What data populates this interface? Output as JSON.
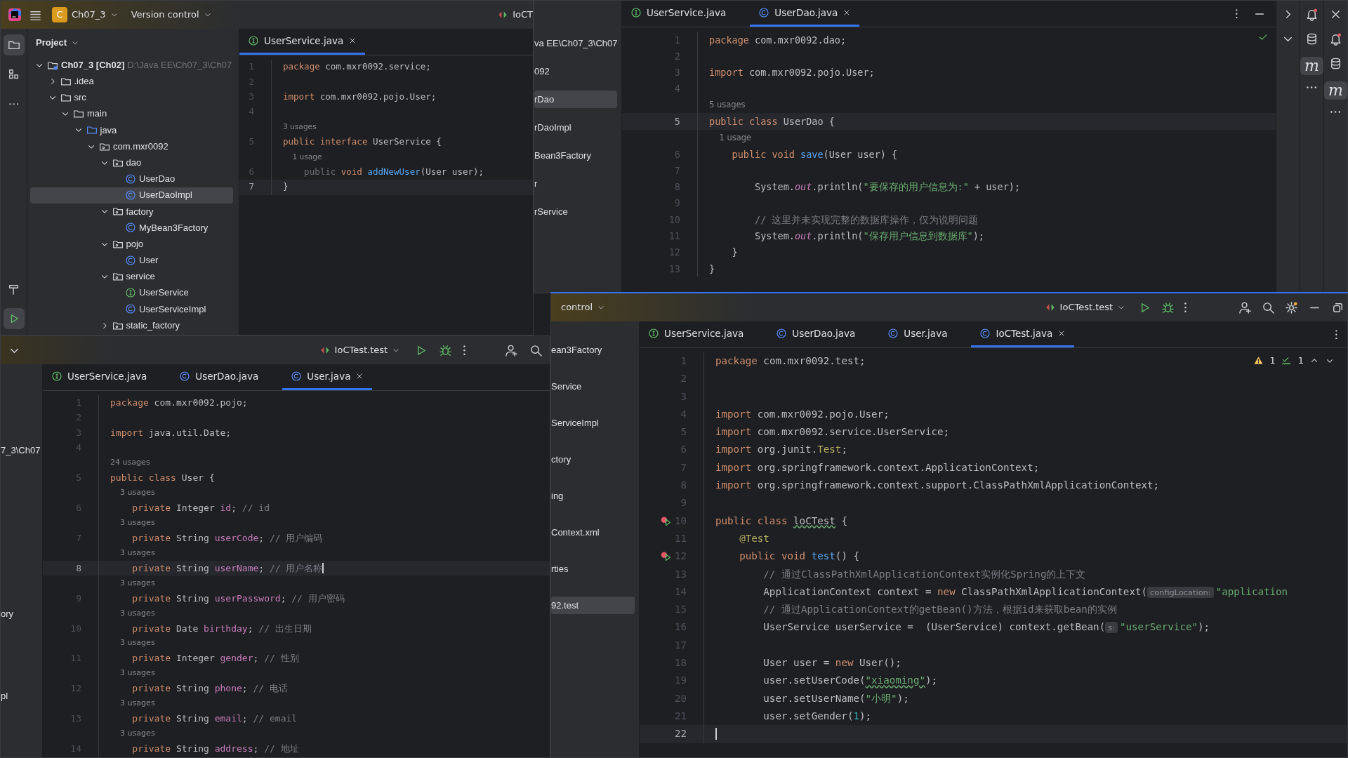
{
  "windows": [
    {
      "header": [
        {
          "kind": "project",
          "badge": "C",
          "label": "Ch07_3"
        },
        {
          "kind": "dropdown",
          "label": "Version control"
        },
        {
          "kind": "runconfig",
          "label": "IoCT",
          "caret": false
        }
      ],
      "tool_strip": [
        {
          "selected": true
        },
        {
          "selected": false
        },
        {
          "selected": false
        },
        {
          "selected": false
        },
        {
          "selected": true
        }
      ],
      "panel": {
        "title": "Project",
        "tree": [
          {
            "label": "Ch07_3 [Ch02]",
            "path": "D:\\Java EE\\Ch07_3\\Ch07",
            "kind": "module",
            "expanded": true,
            "selected": false,
            "children": [
              {
                "label": ".idea",
                "kind": "folder",
                "expanded": false,
                "selected": false
              },
              {
                "label": "src",
                "kind": "folder",
                "expanded": true,
                "selected": false,
                "children": [
                  {
                    "label": "main",
                    "kind": "folder",
                    "expanded": true,
                    "selected": false,
                    "children": [
                      {
                        "label": "java",
                        "kind": "source",
                        "expanded": true,
                        "selected": false,
                        "children": [
                          {
                            "label": "com.mxr0092",
                            "kind": "package",
                            "expanded": true,
                            "selected": false,
                            "children": [
                              {
                                "label": "dao",
                                "kind": "package",
                                "expanded": true,
                                "selected": false,
                                "children": [
                                  {
                                    "label": "UserDao",
                                    "kind": "class",
                                    "selected": false
                                  },
                                  {
                                    "label": "UserDaoImpl",
                                    "kind": "class",
                                    "selected": true
                                  }
                                ]
                              },
                              {
                                "label": "factory",
                                "kind": "package",
                                "expanded": true,
                                "selected": false,
                                "children": [
                                  {
                                    "label": "MyBean3Factory",
                                    "kind": "class",
                                    "selected": false
                                  }
                                ]
                              },
                              {
                                "label": "pojo",
                                "kind": "package",
                                "expanded": true,
                                "selected": false,
                                "children": [
                                  {
                                    "label": "User",
                                    "kind": "class",
                                    "selected": false
                                  }
                                ]
                              },
                              {
                                "label": "service",
                                "kind": "package",
                                "expanded": true,
                                "selected": false,
                                "children": [
                                  {
                                    "label": "UserService",
                                    "kind": "interface",
                                    "selected": false
                                  },
                                  {
                                    "label": "UserServiceImpl",
                                    "kind": "class",
                                    "selected": false
                                  }
                                ]
                              },
                              {
                                "label": "static_factory",
                                "kind": "package",
                                "expanded": false,
                                "selected": false
                              }
                            ]
                          }
                        ]
                      }
                    ]
                  }
                ]
              }
            ]
          }
        ]
      },
      "tabs": [
        {
          "label": "UserService.java",
          "kind": "interface",
          "selected": true
        }
      ],
      "editor": {
        "caret": false,
        "lines": [
          {
            "kind": "code",
            "number": "1",
            "current": false,
            "segments": [
              {
                "kind": "kw",
                "text": "package"
              },
              {
                "kind": "t",
                "text": " com.mxr0092.service;"
              }
            ]
          },
          {
            "kind": "code",
            "number": "2",
            "current": false
          },
          {
            "kind": "code",
            "number": "3",
            "current": false,
            "segments": [
              {
                "kind": "kw",
                "text": "import"
              },
              {
                "kind": "t",
                "text": " com.mxr0092.pojo.User;"
              }
            ]
          },
          {
            "kind": "code",
            "number": "4",
            "current": false
          },
          {
            "kind": "usage",
            "text": "3 usages"
          },
          {
            "kind": "code",
            "number": "5",
            "current": false,
            "segments": [
              {
                "kind": "kw",
                "text": "public interface"
              },
              {
                "kind": "t",
                "text": " UserService {"
              }
            ]
          },
          {
            "kind": "usage",
            "text": "    1 usage"
          },
          {
            "kind": "code",
            "number": "6",
            "current": false,
            "segments": [
              {
                "kind": "dim",
                "text": "    public"
              },
              {
                "kind": "kw",
                "text": " void"
              },
              {
                "kind": "fn",
                "text": " addNewUser"
              },
              {
                "kind": "t",
                "text": "(User user);"
              }
            ]
          },
          {
            "kind": "code",
            "number": "7",
            "current": true,
            "segments": [
              {
                "kind": "t",
                "text": "}"
              }
            ]
          }
        ]
      }
    },
    {
      "panel": {
        "fragments": [
          {
            "text": "va EE\\Ch07_3\\Ch07",
            "selected": false
          },
          {
            "text": "092",
            "selected": false
          },
          {
            "text": "rDao",
            "selected": true
          },
          {
            "text": "rDaoImpl",
            "selected": false
          },
          {
            "text": "Bean3Factory",
            "selected": false
          },
          {
            "text": "r",
            "selected": false
          },
          {
            "text": "rService",
            "selected": false
          }
        ]
      },
      "tabs": [
        {
          "label": "UserService.java",
          "kind": "interface",
          "selected": false
        },
        {
          "label": "UserDao.java",
          "kind": "class",
          "selected": true
        }
      ],
      "tool_labels": [
        "m",
        "m"
      ],
      "editor": {
        "caret": false,
        "checks_passed": true,
        "lines": [
          {
            "kind": "code",
            "number": "1",
            "current": false,
            "segments": [
              {
                "kind": "kw",
                "text": "package"
              },
              {
                "kind": "t",
                "text": " com.mxr0092.dao;"
              }
            ]
          },
          {
            "kind": "code",
            "number": "2",
            "current": false
          },
          {
            "kind": "code",
            "number": "3",
            "current": false,
            "segments": [
              {
                "kind": "kw",
                "text": "import"
              },
              {
                "kind": "t",
                "text": " com.mxr0092.pojo.User;"
              }
            ]
          },
          {
            "kind": "code",
            "number": "4",
            "current": false
          },
          {
            "kind": "usage",
            "text": "5 usages"
          },
          {
            "kind": "code",
            "number": "5",
            "current": true,
            "segments": [
              {
                "kind": "kw",
                "text": "public class"
              },
              {
                "kind": "t",
                "text": " UserDao {"
              }
            ]
          },
          {
            "kind": "usage",
            "text": "    1 usage"
          },
          {
            "kind": "code",
            "number": "6",
            "current": false,
            "segments": [
              {
                "kind": "kw",
                "text": "    public void"
              },
              {
                "kind": "fn",
                "text": " save"
              },
              {
                "kind": "t",
                "text": "(User user) {"
              }
            ]
          },
          {
            "kind": "code",
            "number": "7",
            "current": false
          },
          {
            "kind": "code",
            "number": "8",
            "current": false,
            "segments": [
              {
                "kind": "t",
                "text": "        System."
              },
              {
                "kind": "static",
                "text": "out"
              },
              {
                "kind": "t",
                "text": ".println("
              },
              {
                "kind": "str",
                "text": "\"要保存的用户信息为:\""
              },
              {
                "kind": "t",
                "text": " + user);"
              }
            ]
          },
          {
            "kind": "code",
            "number": "9",
            "current": false
          },
          {
            "kind": "code",
            "number": "10",
            "current": false,
            "segments": [
              {
                "kind": "cmt",
                "text": "        // 这里并未实现完整的数据库操作，仅为说明问题"
              }
            ]
          },
          {
            "kind": "code",
            "number": "11",
            "current": false,
            "segments": [
              {
                "kind": "t",
                "text": "        System."
              },
              {
                "kind": "static",
                "text": "out"
              },
              {
                "kind": "t",
                "text": ".println("
              },
              {
                "kind": "str",
                "text": "\"保存用户信息到数据库\""
              },
              {
                "kind": "t",
                "text": ");"
              }
            ]
          },
          {
            "kind": "code",
            "number": "12",
            "current": false,
            "segments": [
              {
                "kind": "t",
                "text": "    }"
              }
            ]
          },
          {
            "kind": "code",
            "number": "13",
            "current": false,
            "segments": [
              {
                "kind": "t",
                "text": "}"
              }
            ]
          }
        ]
      }
    },
    {
      "header": [
        {
          "kind": "runconfig",
          "label": "IoCTest.test",
          "caret": true
        }
      ],
      "panel": {
        "fragments": [
          {
            "text": "7_3\\Ch07",
            "selected": false
          },
          {
            "text": "ory",
            "selected": false
          },
          {
            "text": "pl",
            "selected": false
          }
        ]
      },
      "tabs": [
        {
          "label": "UserService.java",
          "kind": "interface",
          "selected": false
        },
        {
          "label": "UserDao.java",
          "kind": "class",
          "selected": false
        },
        {
          "label": "User.java",
          "kind": "class",
          "selected": true
        }
      ],
      "editor": {
        "caret": true,
        "lines": [
          {
            "kind": "code",
            "number": "1",
            "current": false,
            "segments": [
              {
                "kind": "kw",
                "text": "package"
              },
              {
                "kind": "t",
                "text": " com.mxr0092.pojo;"
              }
            ]
          },
          {
            "kind": "code",
            "number": "2",
            "current": false
          },
          {
            "kind": "code",
            "number": "3",
            "current": false,
            "segments": [
              {
                "kind": "kw",
                "text": "import"
              },
              {
                "kind": "t",
                "text": " java.util.Date;"
              }
            ]
          },
          {
            "kind": "code",
            "number": "4",
            "current": false
          },
          {
            "kind": "usage",
            "text": "24 usages"
          },
          {
            "kind": "code",
            "number": "5",
            "current": false,
            "segments": [
              {
                "kind": "kw",
                "text": "public class"
              },
              {
                "kind": "t",
                "text": " User {"
              }
            ]
          },
          {
            "kind": "usage",
            "text": "    3 usages"
          },
          {
            "kind": "code",
            "number": "6",
            "current": false,
            "segments": [
              {
                "kind": "kw",
                "text": "    private"
              },
              {
                "kind": "t",
                "text": " Integer "
              },
              {
                "kind": "fld",
                "text": "id"
              },
              {
                "kind": "t",
                "text": "; "
              },
              {
                "kind": "cmt",
                "text": "// id"
              }
            ]
          },
          {
            "kind": "usage",
            "text": "    3 usages"
          },
          {
            "kind": "code",
            "number": "7",
            "current": false,
            "segments": [
              {
                "kind": "kw",
                "text": "    private"
              },
              {
                "kind": "t",
                "text": " String "
              },
              {
                "kind": "fld",
                "text": "userCode"
              },
              {
                "kind": "t",
                "text": "; "
              },
              {
                "kind": "cmt",
                "text": "// 用户编码"
              }
            ]
          },
          {
            "kind": "usage",
            "text": "    3 usages"
          },
          {
            "kind": "code",
            "number": "8",
            "current": true,
            "segments": [
              {
                "kind": "kw",
                "text": "    private"
              },
              {
                "kind": "t",
                "text": " String "
              },
              {
                "kind": "fld",
                "text": "userName"
              },
              {
                "kind": "t",
                "text": "; "
              },
              {
                "kind": "cmt",
                "text": "// 用户名称"
              }
            ]
          },
          {
            "kind": "usage",
            "text": "    3 usages"
          },
          {
            "kind": "code",
            "number": "9",
            "current": false,
            "segments": [
              {
                "kind": "kw",
                "text": "    private"
              },
              {
                "kind": "t",
                "text": " String "
              },
              {
                "kind": "fld",
                "text": "userPassword"
              },
              {
                "kind": "t",
                "text": "; "
              },
              {
                "kind": "cmt",
                "text": "// 用户密码"
              }
            ]
          },
          {
            "kind": "usage",
            "text": "    3 usages"
          },
          {
            "kind": "code",
            "number": "10",
            "current": false,
            "segments": [
              {
                "kind": "kw",
                "text": "    private"
              },
              {
                "kind": "t",
                "text": " Date "
              },
              {
                "kind": "fld",
                "text": "birthday"
              },
              {
                "kind": "t",
                "text": "; "
              },
              {
                "kind": "cmt",
                "text": "// 出生日期"
              }
            ]
          },
          {
            "kind": "usage",
            "text": "    3 usages"
          },
          {
            "kind": "code",
            "number": "11",
            "current": false,
            "segments": [
              {
                "kind": "kw",
                "text": "    private"
              },
              {
                "kind": "t",
                "text": " Integer "
              },
              {
                "kind": "fld",
                "text": "gender"
              },
              {
                "kind": "t",
                "text": "; "
              },
              {
                "kind": "cmt",
                "text": "// 性别"
              }
            ]
          },
          {
            "kind": "usage",
            "text": "    3 usages"
          },
          {
            "kind": "code",
            "number": "12",
            "current": false,
            "segments": [
              {
                "kind": "kw",
                "text": "    private"
              },
              {
                "kind": "t",
                "text": " String "
              },
              {
                "kind": "fld",
                "text": "phone"
              },
              {
                "kind": "t",
                "text": "; "
              },
              {
                "kind": "cmt",
                "text": "// 电话"
              }
            ]
          },
          {
            "kind": "usage",
            "text": "    3 usages"
          },
          {
            "kind": "code",
            "number": "13",
            "current": false,
            "segments": [
              {
                "kind": "kw",
                "text": "    private"
              },
              {
                "kind": "t",
                "text": " String "
              },
              {
                "kind": "fld",
                "text": "email"
              },
              {
                "kind": "t",
                "text": "; "
              },
              {
                "kind": "cmt",
                "text": "// email"
              }
            ]
          },
          {
            "kind": "usage",
            "text": "    3 usages"
          },
          {
            "kind": "code",
            "number": "14",
            "current": false,
            "segments": [
              {
                "kind": "kw",
                "text": "    private"
              },
              {
                "kind": "t",
                "text": " String "
              },
              {
                "kind": "fld",
                "text": "address"
              },
              {
                "kind": "t",
                "text": "; "
              },
              {
                "kind": "cmt",
                "text": "// 地址"
              }
            ]
          }
        ]
      }
    },
    {
      "header": [
        {
          "kind": "dropdown",
          "label": "control"
        },
        {
          "kind": "runconfig",
          "label": "IoCTest.test",
          "caret": true
        }
      ],
      "panel": {
        "fragments": [
          {
            "text": "ean3Factory",
            "selected": false
          },
          {
            "text": "Service",
            "selected": false
          },
          {
            "text": "ServiceImpl",
            "selected": false
          },
          {
            "text": "ctory",
            "selected": false
          },
          {
            "text": "ing",
            "selected": false
          },
          {
            "text": "Context.xml",
            "selected": false
          },
          {
            "text": "rties",
            "selected": false
          },
          {
            "text": "92.test",
            "selected": true
          }
        ]
      },
      "tabs": [
        {
          "label": "UserService.java",
          "kind": "interface",
          "selected": false
        },
        {
          "label": "UserDao.java",
          "kind": "class",
          "selected": false
        },
        {
          "label": "User.java",
          "kind": "class",
          "selected": false
        },
        {
          "label": "IoCTest.java",
          "kind": "class",
          "selected": true
        }
      ],
      "editor": {
        "caret": true,
        "inspection": {
          "warnings": "1",
          "typos": "1"
        },
        "lines": [
          {
            "kind": "code",
            "number": "1",
            "current": false,
            "run_marker": false,
            "segments": [
              {
                "kind": "kw",
                "text": "package"
              },
              {
                "kind": "t",
                "text": " com.mxr0092.test;"
              }
            ]
          },
          {
            "kind": "code",
            "number": "2",
            "current": false,
            "run_marker": false
          },
          {
            "kind": "code",
            "number": "3",
            "current": false,
            "run_marker": false
          },
          {
            "kind": "code",
            "number": "4",
            "current": false,
            "run_marker": false,
            "segments": [
              {
                "kind": "kw",
                "text": "import"
              },
              {
                "kind": "t",
                "text": " com.mxr0092.pojo.User;"
              }
            ]
          },
          {
            "kind": "code",
            "number": "5",
            "current": false,
            "run_marker": false,
            "segments": [
              {
                "kind": "kw",
                "text": "import"
              },
              {
                "kind": "t",
                "text": " com.mxr0092.service.UserService;"
              }
            ]
          },
          {
            "kind": "code",
            "number": "6",
            "current": false,
            "run_marker": false,
            "segments": [
              {
                "kind": "kw",
                "text": "import"
              },
              {
                "kind": "t",
                "text": " org.junit."
              },
              {
                "kind": "ann",
                "text": "Test"
              },
              {
                "kind": "t",
                "text": ";"
              }
            ]
          },
          {
            "kind": "code",
            "number": "7",
            "current": false,
            "run_marker": false,
            "segments": [
              {
                "kind": "kw",
                "text": "import"
              },
              {
                "kind": "t",
                "text": " org.springframework.context.ApplicationContext;"
              }
            ]
          },
          {
            "kind": "code",
            "number": "8",
            "current": false,
            "run_marker": false,
            "segments": [
              {
                "kind": "kw",
                "text": "import"
              },
              {
                "kind": "t",
                "text": " org.springframework.context.support.ClassPathXmlApplicationContext;"
              }
            ]
          },
          {
            "kind": "code",
            "number": "9",
            "current": false,
            "run_marker": false
          },
          {
            "kind": "code",
            "number": "10",
            "current": false,
            "run_marker": true,
            "segments": [
              {
                "kind": "kw",
                "text": "public class "
              },
              {
                "kind": "typo",
                "text": "loCTest"
              },
              {
                "kind": "t",
                "text": " {"
              }
            ]
          },
          {
            "kind": "code",
            "number": "11",
            "current": false,
            "run_marker": false,
            "segments": [
              {
                "kind": "ann",
                "text": "    @Test"
              }
            ]
          },
          {
            "kind": "code",
            "number": "12",
            "current": false,
            "run_marker": true,
            "segments": [
              {
                "kind": "kw",
                "text": "    public void"
              },
              {
                "kind": "fn",
                "text": " test"
              },
              {
                "kind": "t",
                "text": "() {"
              }
            ]
          },
          {
            "kind": "code",
            "number": "13",
            "current": false,
            "run_marker": false,
            "segments": [
              {
                "kind": "cmt",
                "text": "        // 通过ClassPathXmlApplicationContext实例化Spring的上下文"
              }
            ]
          },
          {
            "kind": "code",
            "number": "14",
            "current": false,
            "run_marker": false,
            "segments": [
              {
                "kind": "t",
                "text": "        ApplicationContext context = "
              },
              {
                "kind": "kw",
                "text": "new"
              },
              {
                "kind": "t",
                "text": " ClassPathXmlApplicationContext("
              },
              {
                "kind": "hint",
                "text": "configLocation:"
              },
              {
                "kind": "str",
                "text": "\"application"
              }
            ]
          },
          {
            "kind": "code",
            "number": "15",
            "current": false,
            "run_marker": false,
            "segments": [
              {
                "kind": "cmt",
                "text": "        // 通过ApplicationContext的getBean()方法，根据id来获取bean的实例"
              }
            ]
          },
          {
            "kind": "code",
            "number": "16",
            "current": false,
            "run_marker": false,
            "segments": [
              {
                "kind": "t",
                "text": "        UserService userService =  (UserService) context.getBean("
              },
              {
                "kind": "hint",
                "text": "s:"
              },
              {
                "kind": "str",
                "text": "\"userService\""
              },
              {
                "kind": "t",
                "text": ");"
              }
            ]
          },
          {
            "kind": "code",
            "number": "17",
            "current": false,
            "run_marker": false
          },
          {
            "kind": "code",
            "number": "18",
            "current": false,
            "run_marker": false,
            "segments": [
              {
                "kind": "t",
                "text": "        User user = "
              },
              {
                "kind": "kw",
                "text": "new"
              },
              {
                "kind": "t",
                "text": " User();"
              }
            ]
          },
          {
            "kind": "code",
            "number": "19",
            "current": false,
            "run_marker": false,
            "segments": [
              {
                "kind": "t",
                "text": "        user.setUserCode("
              },
              {
                "kind": "strtypo",
                "text": "\"xiaoming\""
              },
              {
                "kind": "t",
                "text": ");"
              }
            ]
          },
          {
            "kind": "code",
            "number": "20",
            "current": false,
            "run_marker": false,
            "segments": [
              {
                "kind": "t",
                "text": "        user.setUserName("
              },
              {
                "kind": "str",
                "text": "\"小明\""
              },
              {
                "kind": "t",
                "text": ");"
              }
            ]
          },
          {
            "kind": "code",
            "number": "21",
            "current": false,
            "run_marker": false,
            "segments": [
              {
                "kind": "t",
                "text": "        user.setGender("
              },
              {
                "kind": "num",
                "text": "1"
              },
              {
                "kind": "t",
                "text": ");"
              }
            ]
          },
          {
            "kind": "code",
            "number": "22",
            "current": true,
            "run_marker": false
          }
        ]
      }
    }
  ]
}
